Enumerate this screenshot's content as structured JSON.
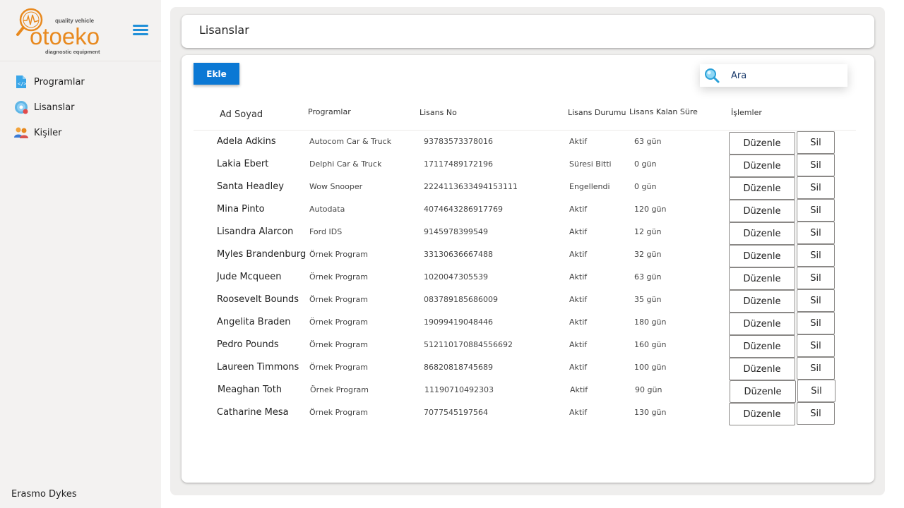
{
  "brand": {
    "tagline_top": "quality vehicle",
    "logo_text": "otoeko",
    "tagline_bottom": "diagnostic equipment"
  },
  "sidebar": {
    "items": [
      {
        "label": "Programlar",
        "icon": "code-file-icon"
      },
      {
        "label": "Lisanslar",
        "icon": "disc-icon"
      },
      {
        "label": "Kişiler",
        "icon": "people-icon"
      }
    ],
    "user_name": "Erasmo Dykes"
  },
  "header": {
    "title": "Lisanslar"
  },
  "toolbar": {
    "add_label": "Ekle",
    "search_placeholder": "Ara"
  },
  "table": {
    "columns": [
      "Ad Soyad",
      "Programlar",
      "Lisans No",
      "Lisans Durumu",
      "Lisans Kalan Süre",
      "İşlemler"
    ],
    "edit_label": "Düzenle",
    "delete_label": "Sil",
    "rows": [
      {
        "name": "Adela Adkins",
        "program": "Autocom Car & Truck",
        "license_no": "93783573378016",
        "status": "Aktif",
        "remaining": "63 gün"
      },
      {
        "name": "Lakia Ebert",
        "program": "Delphi Car & Truck",
        "license_no": "17117489172196",
        "status": "Süresi Bitti",
        "remaining": "0 gün"
      },
      {
        "name": "Santa Headley",
        "program": "Wow Snooper",
        "license_no": "2224113633494153111",
        "status": "Engellendi",
        "remaining": "0 gün"
      },
      {
        "name": "Mina Pinto",
        "program": "Autodata",
        "license_no": "4074643286917769",
        "status": "Aktif",
        "remaining": "120 gün"
      },
      {
        "name": "Lisandra Alarcon",
        "program": "Ford IDS",
        "license_no": "9145978399549",
        "status": "Aktif",
        "remaining": "12 gün"
      },
      {
        "name": "Myles Brandenburg",
        "program": "Örnek Program",
        "license_no": "33130636667488",
        "status": "Aktif",
        "remaining": "32 gün"
      },
      {
        "name": "Jude Mcqueen",
        "program": "Örnek Program",
        "license_no": "1020047305539",
        "status": "Aktif",
        "remaining": "63 gün"
      },
      {
        "name": "Roosevelt Bounds",
        "program": "Örnek Program",
        "license_no": "083789185686009",
        "status": "Aktif",
        "remaining": "35 gün"
      },
      {
        "name": "Angelita Braden",
        "program": "Örnek Program",
        "license_no": "19099419048446",
        "status": "Aktif",
        "remaining": "180 gün"
      },
      {
        "name": "Pedro Pounds",
        "program": "Örnek Program",
        "license_no": "512110170884556692",
        "status": "Aktif",
        "remaining": "160 gün"
      },
      {
        "name": "Laureen Timmons",
        "program": "Örnek Program",
        "license_no": "86820818745689",
        "status": "Aktif",
        "remaining": "100 gün"
      },
      {
        "name": "Meaghan Toth",
        "program": "Örnek Program",
        "license_no": "11190710492303",
        "status": "Aktif",
        "remaining": "90 gün"
      },
      {
        "name": "Catharine Mesa",
        "program": "Örnek Program",
        "license_no": "7077545197564",
        "status": "Aktif",
        "remaining": "130 gün"
      }
    ]
  },
  "colors": {
    "accent": "#0b78d4",
    "brand_orange": "#e8891e",
    "sidebar_bg": "#f3f2f1"
  }
}
